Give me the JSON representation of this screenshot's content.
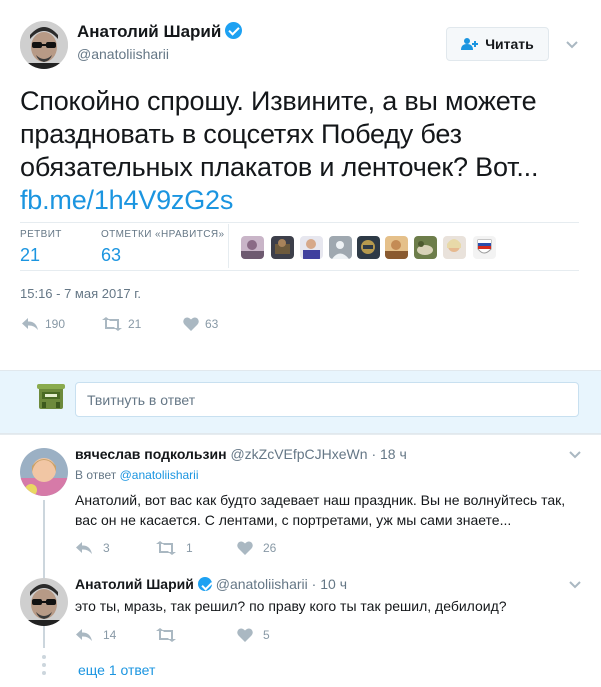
{
  "tweet": {
    "author_name": "Анатолий Шарий",
    "author_handle": "@anatoliisharii",
    "follow_label": "Читать",
    "text": "Спокойно спрошу. Извините, а вы можете праздновать в соцсетях Победу без обязательных плакатов и ленточек? Вот...",
    "link": "fb.me/1h4V9zG2s",
    "stats": {
      "retweets_label": "РЕТВИТ",
      "retweets": "21",
      "likes_label": "ОТМЕТКИ «НРАВИТСЯ»",
      "likes": "63"
    },
    "timestamp": "15:16 - 7 мая 2017 г.",
    "actions": {
      "replies": "190",
      "retweets": "21",
      "likes": "63"
    },
    "accent": "#1b95e0",
    "verified_color": "#1da1f2"
  },
  "reply_box": {
    "placeholder": "Твитнуть в ответ"
  },
  "replies": [
    {
      "name": "вячеслав подкользин",
      "handle": "@zkZcVEfpCJHxeWn",
      "time": "18 ч",
      "reply_to_prefix": "В ответ",
      "reply_to": "@anatoliisharii",
      "text": "Анатолий,  вот вас как будто задевает наш праздник. Вы не волнуйтесь так, вас он не касается. С лентами, с портретами, уж мы сами знаете...",
      "replies": "3",
      "retweets": "1",
      "likes": "26"
    },
    {
      "name": "Анатолий Шарий",
      "handle": "@anatoliisharii",
      "time": "10 ч",
      "text": "это ты, мразь, так решил? по праву кого ты так решил, дебилоид?",
      "replies": "14",
      "retweets": "",
      "likes": "5"
    }
  ],
  "more_replies": "еще 1 ответ"
}
